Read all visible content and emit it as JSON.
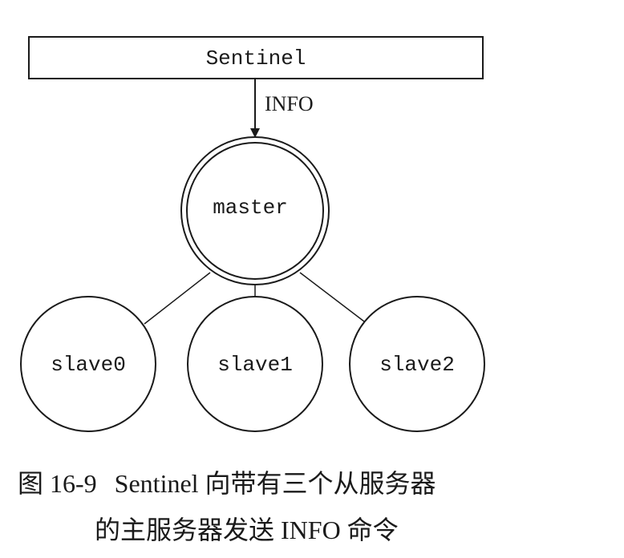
{
  "diagram": {
    "sentinel_label": "Sentinel",
    "arrow_label": "INFO",
    "master_label": "master",
    "slaves": [
      {
        "label": "slave0"
      },
      {
        "label": "slave1"
      },
      {
        "label": "slave2"
      }
    ]
  },
  "caption": {
    "figure_number": "图 16-9",
    "line1_text": "Sentinel 向带有三个从服务器",
    "line2_text": "的主服务器发送 INFO 命令"
  }
}
